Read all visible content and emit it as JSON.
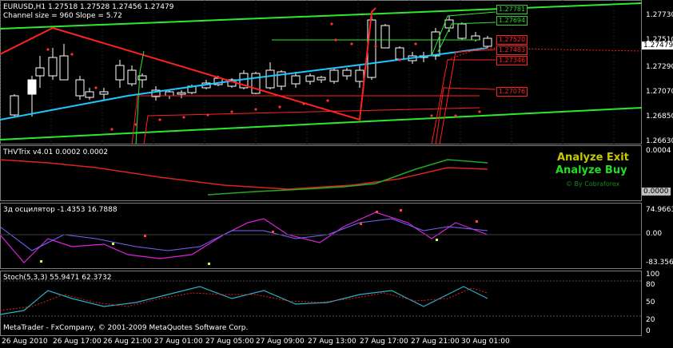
{
  "window": {
    "main_title": "EURUSD,H1  1.27518 1.27528 1.27456 1.27479",
    "channel_info": "Channel size = 960 Slope = 5.72",
    "footer": "MetaTrader - FxCompany, © 2001-2009 MetaQuotes Software Corp."
  },
  "main_pane": {
    "price_axis": [
      "1.27730",
      "1.27510",
      "1.27290",
      "1.27070",
      "1.26850",
      "1.26630"
    ],
    "current_price": "1.27479",
    "level_boxes": [
      {
        "text": "1.27781",
        "color": "#33cc33"
      },
      {
        "text": "1.27694",
        "color": "#33cc33"
      },
      {
        "text": "1.27520",
        "color": "#ff2020"
      },
      {
        "text": "1.27483",
        "color": "#ff2020"
      },
      {
        "text": "1.27346",
        "color": "#ff2020"
      },
      {
        "text": "1.27076",
        "color": "#ff2020"
      }
    ]
  },
  "thv_pane": {
    "title": "THVTrix v4.01 0.0002 0.0002",
    "axis_top": "0.0004",
    "axis_bottom": "0.0000",
    "analyze_exit": "Analyze Exit",
    "analyze_buy": "Analyze Buy",
    "credit": "© By Cobraforex",
    "colors": {
      "exit": "#c8c800",
      "buy": "#22dd22",
      "credit": "#1a8a1a"
    }
  },
  "osc_pane": {
    "title": "3д осцилятор -1.4353 16.7888",
    "axis": [
      "74.9663",
      "0.00",
      "-83.3562"
    ]
  },
  "stoch_pane": {
    "title": "Stoch(5,3,3) 55.9471 62.3732",
    "axis": [
      "100",
      "80",
      "50",
      "20",
      "0"
    ]
  },
  "time_axis": [
    "26 Aug 2010",
    "26 Aug 17:00",
    "26 Aug 21:00",
    "27 Aug 01:00",
    "27 Aug 05:00",
    "27 Aug 09:00",
    "27 Aug 13:00",
    "27 Aug 17:00",
    "27 Aug 21:00",
    "30 Aug 01:00"
  ]
}
